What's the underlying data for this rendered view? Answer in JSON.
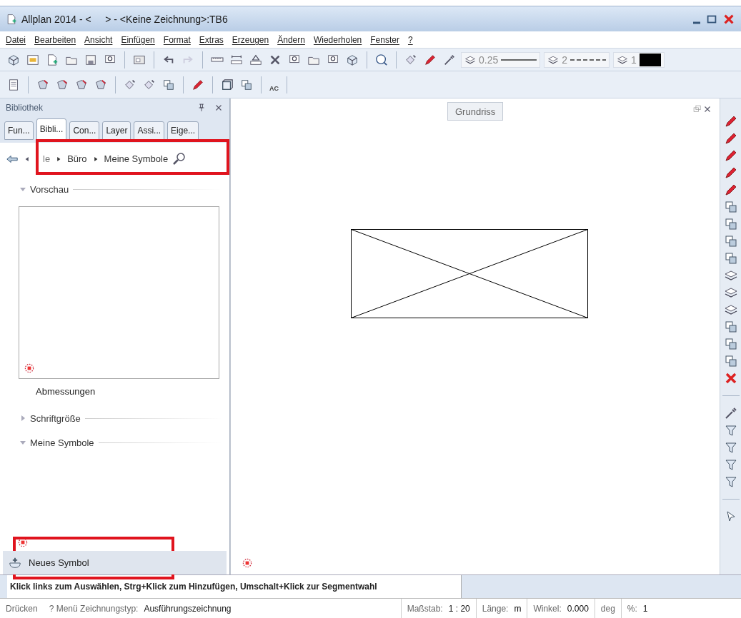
{
  "window": {
    "title": "Allplan 2014 - <     > - <Keine Zeichnung>:TB6"
  },
  "menu": [
    "Datei",
    "Bearbeiten",
    "Ansicht",
    "Einfügen",
    "Format",
    "Extras",
    "Erzeugen",
    "Ändern",
    "Wiederholen",
    "Fenster",
    "?"
  ],
  "toolbar": {
    "pen": "0.25",
    "line": "2",
    "color_number": "1",
    "text_button": "AC"
  },
  "panel": {
    "title": "Bibliothek",
    "tabs": [
      {
        "label": "Fun...",
        "selected": false
      },
      {
        "label": "Bibli...",
        "selected": true
      },
      {
        "label": "Con...",
        "selected": false
      },
      {
        "label": "Layer",
        "selected": false
      },
      {
        "label": "Assi...",
        "selected": false
      },
      {
        "label": "Eige...",
        "selected": false
      }
    ],
    "breadcrumb": {
      "highlighted": true,
      "items": [
        "le",
        "Büro",
        "Meine Symbole"
      ]
    },
    "sections": [
      {
        "title": "Vorschau",
        "expanded": true
      },
      {
        "title": "Schriftgröße",
        "expanded": false
      },
      {
        "title": "Meine Symbole",
        "expanded": true
      }
    ],
    "preview_label": "Abmessungen",
    "new_item": {
      "label": "Neues Symbol",
      "highlighted": true
    }
  },
  "canvas": {
    "tab": "Grundriss"
  },
  "prompt": "Klick links zum Auswählen, Strg+Klick zum Hinzufügen, Umschalt+Klick zur Segmentwahl",
  "status_bar": [
    {
      "label": "Drücken"
    },
    {
      "label": "? Menü Zeichnungstyp:",
      "value": "Ausführungszeichnung"
    },
    {
      "label": "Maßstab:",
      "value": "1 : 20"
    },
    {
      "label": "Länge:",
      "value": "m"
    },
    {
      "label": "Winkel:",
      "value": "0.000"
    },
    {
      "label": "deg"
    },
    {
      "label": "%:",
      "value": "1"
    }
  ]
}
